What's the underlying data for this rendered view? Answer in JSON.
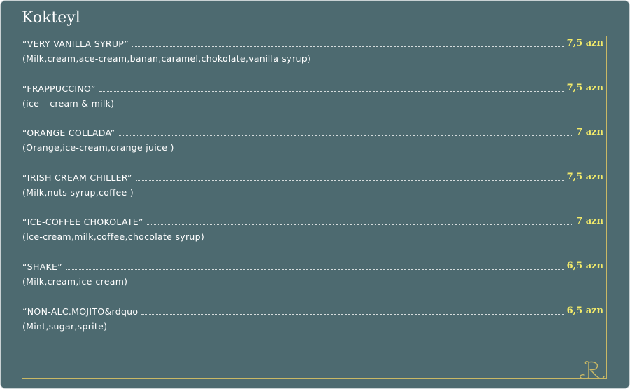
{
  "page": {
    "title": "Kokteyl"
  },
  "colors": {
    "background": "#4d6a70",
    "text": "#ffffff",
    "price": "#f2ea6a",
    "frame_line": "#c9b865"
  },
  "menu": {
    "items": [
      {
        "name": "“VERY VANILLA SYRUP”",
        "price": "7,5 azn",
        "description": "(Milk,cream,ace-cream,banan,caramel,chokolate,vanilla syrup)"
      },
      {
        "name": "“FRAPPUCCINO”",
        "price": "7,5 azn",
        "description": "(ice – cream & milk)"
      },
      {
        "name": "“ORANGE COLLADA”",
        "price": "7 azn",
        "description": "(Orange,ice-cream,orange juice )"
      },
      {
        "name": "“IRISH CREAM CHILLER”",
        "price": "7,5 azn",
        "description": "(Milk,nuts syrup,coffee )"
      },
      {
        "name": "“ICE-COFFEE CHOKOLATE”",
        "price": "7 azn",
        "description": "(Ice-cream,milk,coffee,chocolate syrup)"
      },
      {
        "name": "“SHAKE”",
        "price": "6,5 azn",
        "description": "(Milk,cream,ice-cream)"
      },
      {
        "name": "“NON-ALC.MOJITO&rdquo",
        "price": "6,5 azn",
        "description": "(Mint,sugar,sprite)"
      }
    ]
  },
  "icons": {
    "monogram": "r-monogram-icon"
  }
}
